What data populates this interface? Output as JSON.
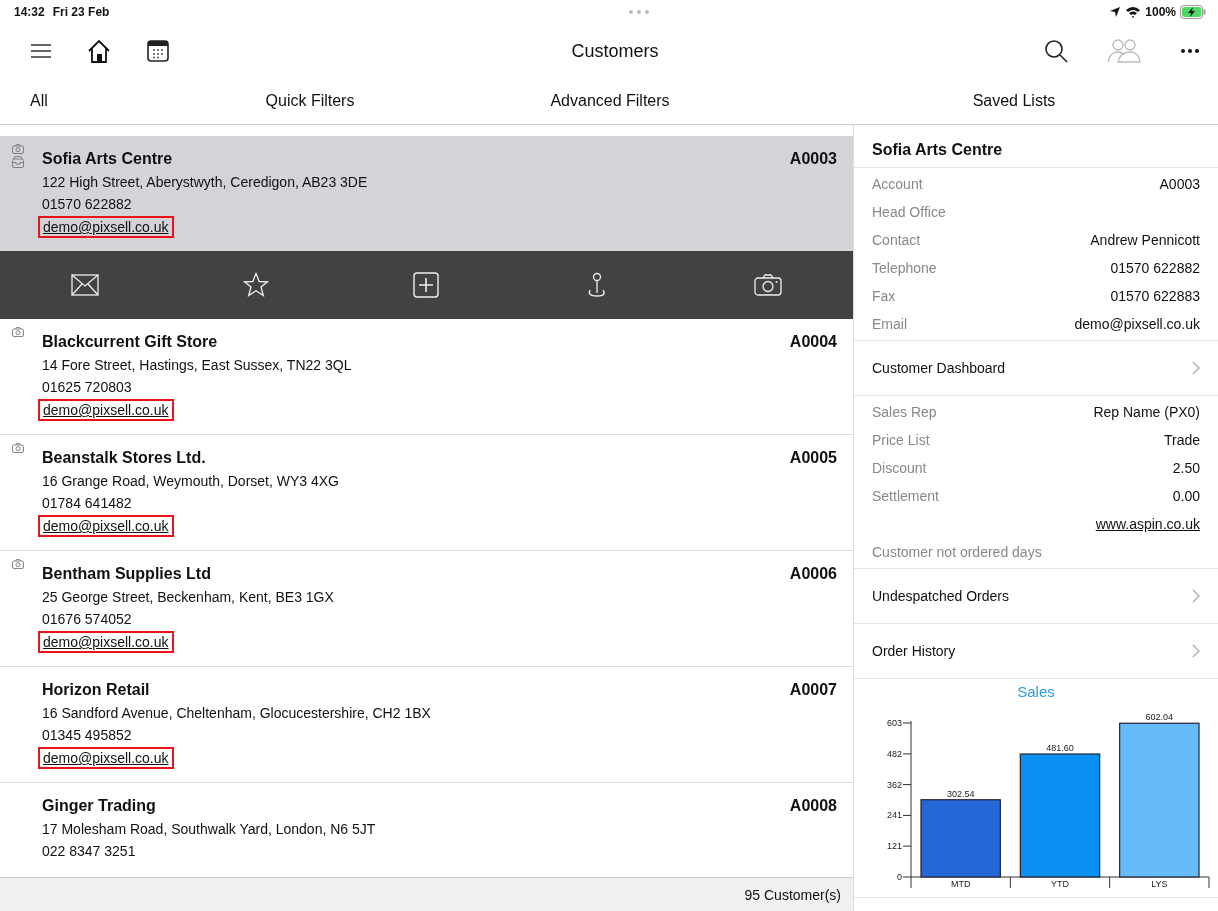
{
  "status_bar": {
    "time": "14:32",
    "date": "Fri 23 Feb",
    "battery": "100%",
    "charging": true
  },
  "nav": {
    "title": "Customers",
    "people_disabled": true
  },
  "tabs": [
    {
      "label": "All",
      "selected": false
    },
    {
      "label": "Quick Filters",
      "selected": false
    },
    {
      "label": "Advanced Filters",
      "selected": false
    },
    {
      "label": "Saved Lists",
      "selected": false
    }
  ],
  "customers": [
    {
      "name": "Sofia Arts Centre",
      "code": "A0003",
      "address": "122 High Street, Aberystwyth, Ceredigon, AB23 3DE",
      "phone": "01570 622882",
      "email": "demo@pixsell.co.uk",
      "selected": true,
      "has_photo": true,
      "has_archive": true,
      "highlighted": true
    },
    {
      "name": "Blackcurrent Gift Store",
      "code": "A0004",
      "address": "14 Fore Street, Hastings, East Sussex, TN22 3QL",
      "phone": "01625 720803",
      "email": "demo@pixsell.co.uk",
      "selected": false,
      "has_photo": true,
      "has_archive": false,
      "highlighted": true
    },
    {
      "name": "Beanstalk Stores Ltd.",
      "code": "A0005",
      "address": "16 Grange Road, Weymouth, Dorset, WY3 4XG",
      "phone": "01784 641482",
      "email": "demo@pixsell.co.uk",
      "selected": false,
      "has_photo": true,
      "has_archive": false,
      "highlighted": true
    },
    {
      "name": "Bentham Supplies Ltd",
      "code": "A0006",
      "address": "25 George Street, Beckenham, Kent, BE3 1GX",
      "phone": "01676 574052",
      "email": "demo@pixsell.co.uk",
      "selected": false,
      "has_photo": true,
      "has_archive": false,
      "highlighted": true
    },
    {
      "name": "Horizon Retail",
      "code": "A0007",
      "address": "16 Sandford Avenue, Cheltenham, Glocucestershire, CH2 1BX",
      "phone": "01345 495852",
      "email": "demo@pixsell.co.uk",
      "selected": false,
      "has_photo": false,
      "has_archive": false,
      "highlighted": true
    },
    {
      "name": "Ginger Trading",
      "code": "A0008",
      "address": "17 Molesham Road, Southwalk Yard, London, N6 5JT",
      "phone": "022 8347 3251",
      "selected": false,
      "has_photo": false,
      "has_archive": false,
      "highlighted": false
    }
  ],
  "action_bar": [
    {
      "kind": "mail"
    },
    {
      "kind": "star"
    },
    {
      "kind": "add"
    },
    {
      "kind": "pin"
    },
    {
      "kind": "camera"
    }
  ],
  "footer": {
    "count": "95 Customer(s)"
  },
  "detail": {
    "title": "Sofia Arts Centre",
    "sections": [
      {
        "kind": "fields",
        "rows": [
          {
            "label": "Account",
            "value": "A0003"
          },
          {
            "label": "Head Office"
          },
          {
            "label": "Contact",
            "value": "Andrew Pennicott"
          },
          {
            "label": "Telephone",
            "value": "01570 622882"
          },
          {
            "label": "Fax",
            "value": "01570 622883"
          },
          {
            "label": "Email",
            "value": "demo@pixsell.co.uk"
          }
        ]
      },
      {
        "kind": "link",
        "label": "Customer Dashboard"
      },
      {
        "kind": "fields",
        "rows": [
          {
            "label": "Sales Rep",
            "value": "Rep Name (PX0)"
          },
          {
            "label": "Price List",
            "value": "Trade"
          },
          {
            "label": "Discount",
            "value": "2.50"
          },
          {
            "label": "Settlement",
            "value": "0.00"
          },
          {
            "link": "www.aspin.co.uk"
          },
          {
            "label": "Customer not ordered days"
          }
        ]
      },
      {
        "kind": "link",
        "label": "Undespatched Orders"
      },
      {
        "kind": "link",
        "label": "Order History"
      }
    ],
    "chart_data": {
      "type": "bar",
      "title": "Sales",
      "categories": [
        "MTD",
        "YTD",
        "LYS"
      ],
      "values": [
        302.54,
        481.6,
        602.04
      ],
      "colors": [
        "#2468d8",
        "#0a90f0",
        "#66bcfa"
      ],
      "ylim": [
        0,
        603
      ],
      "yticks": [
        0,
        121,
        241,
        362,
        482,
        603
      ],
      "value_labels": [
        "302.54",
        "481.60",
        "602.04"
      ]
    }
  }
}
